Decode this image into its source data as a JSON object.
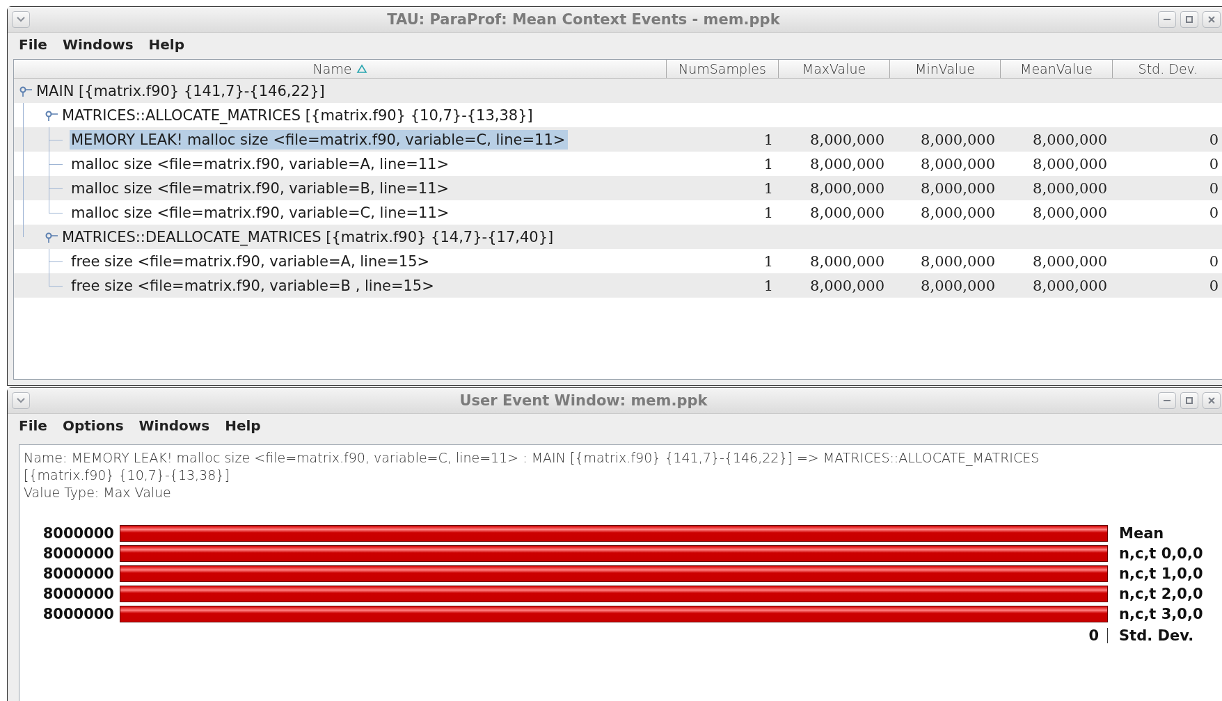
{
  "context_window": {
    "title": "TAU: ParaProf: Mean Context Events - mem.ppk",
    "menu": [
      "File",
      "Windows",
      "Help"
    ],
    "table": {
      "columns": [
        "Name",
        "NumSamples",
        "MaxValue",
        "MinValue",
        "MeanValue",
        "Std. Dev."
      ],
      "tree": [
        {
          "name": "MAIN [{matrix.f90} {141,7}-{146,22}]",
          "expanded": true,
          "selected": false,
          "children": [
            {
              "name": "MATRICES::ALLOCATE_MATRICES [{matrix.f90} {10,7}-{13,38}]",
              "expanded": true,
              "selected": false,
              "children": [
                {
                  "name": "MEMORY LEAK! malloc size <file=matrix.f90, variable=C, line=11>",
                  "selected": true,
                  "values": [
                    "1",
                    "8,000,000",
                    "8,000,000",
                    "8,000,000",
                    "0"
                  ]
                },
                {
                  "name": "malloc size <file=matrix.f90, variable=A, line=11>",
                  "selected": false,
                  "values": [
                    "1",
                    "8,000,000",
                    "8,000,000",
                    "8,000,000",
                    "0"
                  ]
                },
                {
                  "name": "malloc size <file=matrix.f90, variable=B, line=11>",
                  "selected": false,
                  "values": [
                    "1",
                    "8,000,000",
                    "8,000,000",
                    "8,000,000",
                    "0"
                  ]
                },
                {
                  "name": "malloc size <file=matrix.f90, variable=C, line=11>",
                  "selected": false,
                  "values": [
                    "1",
                    "8,000,000",
                    "8,000,000",
                    "8,000,000",
                    "0"
                  ]
                }
              ]
            },
            {
              "name": "MATRICES::DEALLOCATE_MATRICES [{matrix.f90} {14,7}-{17,40}]",
              "expanded": true,
              "selected": false,
              "children": [
                {
                  "name": "free size <file=matrix.f90, variable=A, line=15>",
                  "selected": false,
                  "values": [
                    "1",
                    "8,000,000",
                    "8,000,000",
                    "8,000,000",
                    "0"
                  ]
                },
                {
                  "name": "free size <file=matrix.f90, variable=B , line=15>",
                  "selected": false,
                  "values": [
                    "1",
                    "8,000,000",
                    "8,000,000",
                    "8,000,000",
                    "0"
                  ]
                }
              ]
            }
          ]
        }
      ]
    }
  },
  "user_event_window": {
    "title": "User Event Window: mem.ppk",
    "menu": [
      "File",
      "Options",
      "Windows",
      "Help"
    ],
    "info_lines": [
      "Name: MEMORY LEAK! malloc size <file=matrix.f90, variable=C, line=11> : MAIN [{matrix.f90} {141,7}-{146,22}]    => MATRICES::ALLOCATE_MATRICES",
      "[{matrix.f90} {10,7}-{13,38}]",
      "Value Type: Max Value"
    ],
    "bars": [
      {
        "value": "8000000",
        "label": "Mean"
      },
      {
        "value": "8000000",
        "label": "n,c,t 0,0,0"
      },
      {
        "value": "8000000",
        "label": "n,c,t 1,0,0"
      },
      {
        "value": "8000000",
        "label": "n,c,t 2,0,0"
      },
      {
        "value": "8000000",
        "label": "n,c,t 3,0,0"
      }
    ],
    "std_dev": {
      "value": "0",
      "label": "Std. Dev."
    }
  }
}
